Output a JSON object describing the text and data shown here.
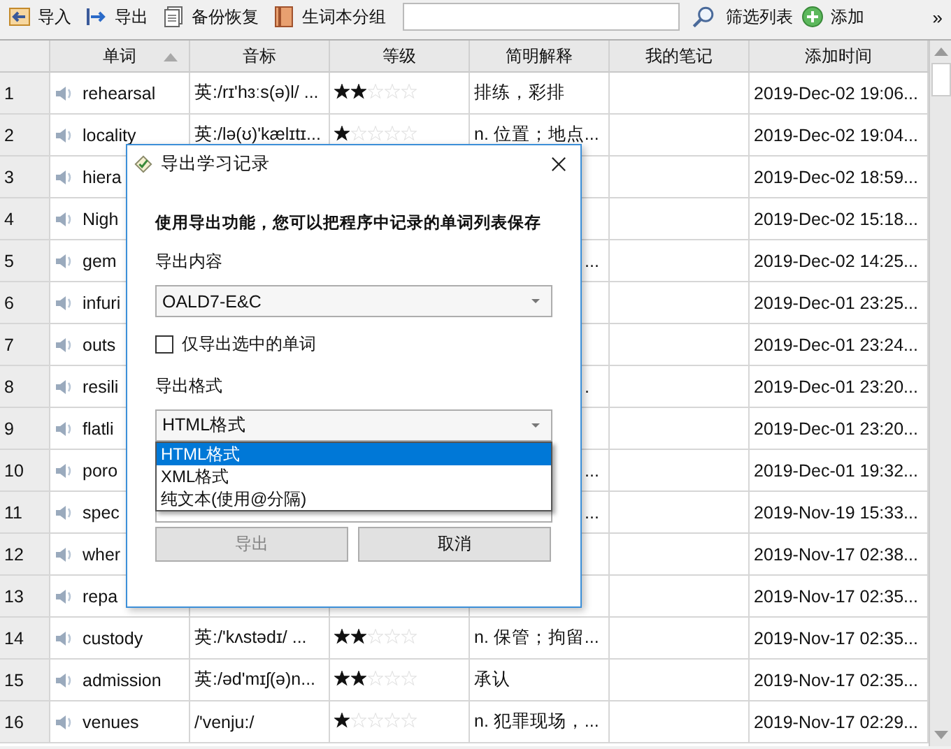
{
  "toolbar": {
    "buttons": [
      {
        "label": "导入",
        "kind": "import"
      },
      {
        "label": "导出",
        "kind": "export"
      },
      {
        "label": "备份恢复",
        "kind": "backup"
      },
      {
        "label": "生词本分组",
        "kind": "book"
      }
    ],
    "filter_label": "筛选列表",
    "add_label": "添加",
    "more": "»"
  },
  "table": {
    "columns": [
      {
        "label": "单词",
        "sorted": true
      },
      {
        "label": "音标",
        "sorted": false
      },
      {
        "label": "等级",
        "sorted": false
      },
      {
        "label": "简明解释",
        "sorted": false
      },
      {
        "label": "我的笔记",
        "sorted": false
      },
      {
        "label": "添加时间",
        "sorted": false
      }
    ],
    "rows": [
      {
        "number": "1",
        "word": "rehearsal",
        "phonetic": "英:/rɪ'hɜːs(ə)l/ ...",
        "stars": 2,
        "meaning": "排练，彩排",
        "added": "2019-Dec-02 19:06..."
      },
      {
        "number": "2",
        "word": "locality",
        "phonetic": "英:/lə(ʊ)'kælɪtɪ...",
        "stars": 1,
        "meaning": "n. 位置；地点...",
        "added": "2019-Dec-02 19:04..."
      },
      {
        "number": "3",
        "word": "hiera",
        "added": "2019-Dec-02 18:59..."
      },
      {
        "number": "4",
        "word": "Nigh",
        "added": "2019-Dec-02 15:18..."
      },
      {
        "number": "5",
        "word": "gem",
        "meaning": "...",
        "added": "2019-Dec-02 14:25..."
      },
      {
        "number": "6",
        "word": "infuri",
        "added": "2019-Dec-01 23:25..."
      },
      {
        "number": "7",
        "word": "outs",
        "added": "2019-Dec-01 23:24..."
      },
      {
        "number": "8",
        "word": "resili",
        "meaning": ".",
        "added": "2019-Dec-01 23:20..."
      },
      {
        "number": "9",
        "word": "flatli",
        "added": "2019-Dec-01 23:20..."
      },
      {
        "number": "10",
        "word": "poro",
        "meaning": "...",
        "added": "2019-Dec-01 19:32..."
      },
      {
        "number": "11",
        "word": "spec",
        "meaning": "...",
        "added": "2019-Nov-19 15:33..."
      },
      {
        "number": "12",
        "word": "wher",
        "added": "2019-Nov-17 02:38..."
      },
      {
        "number": "13",
        "word": "repa",
        "added": "2019-Nov-17 02:35..."
      },
      {
        "number": "14",
        "word": "custody",
        "phonetic": "英:/'kʌstədɪ/ ...",
        "stars": 2,
        "meaning": "n. 保管；拘留...",
        "added": "2019-Nov-17 02:35..."
      },
      {
        "number": "15",
        "word": "admission",
        "phonetic": "英:/əd'mɪʃ(ə)n...",
        "stars": 2,
        "meaning": "承认",
        "added": "2019-Nov-17 02:35..."
      },
      {
        "number": "16",
        "word": "venues",
        "phonetic": "/'venju:/",
        "stars": 1,
        "meaning": "n. 犯罪现场，...",
        "added": "2019-Nov-17 02:29..."
      }
    ]
  },
  "dialog": {
    "title": "导出学习记录",
    "intro": "使用导出功能，您可以把程序中记录的单词列表保存",
    "content_label": "导出内容",
    "content_value": "OALD7-E&C",
    "only_selected": {
      "label": "仅导出选中的单词",
      "checked": false
    },
    "format_label": "导出格式",
    "format_value": "HTML格式",
    "format_open": true,
    "format_options": [
      {
        "label": "HTML格式",
        "selected": true
      },
      {
        "label": "XML格式",
        "selected": false
      },
      {
        "label": "纯文本(使用@分隔)",
        "selected": false
      }
    ],
    "buttons": [
      {
        "label": "导出",
        "disabled": true
      },
      {
        "label": "取消",
        "disabled": false
      }
    ]
  }
}
